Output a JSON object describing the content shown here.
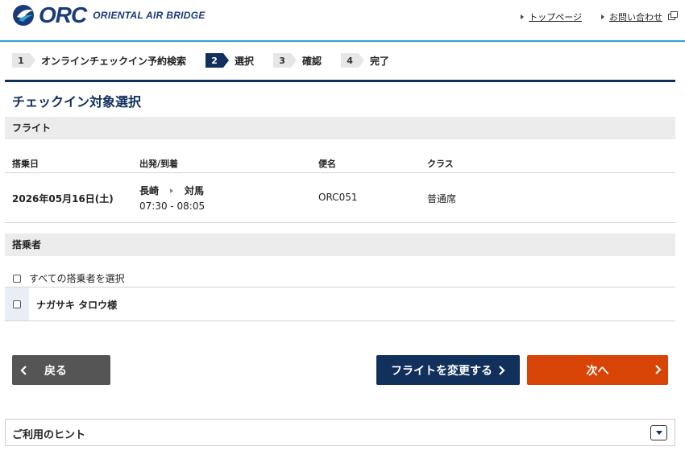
{
  "header": {
    "logo_text": "ORC",
    "logo_sub": "ORIENTAL AIR BRIDGE",
    "links": [
      {
        "label": "トップページ"
      },
      {
        "label": "お問い合わせ"
      }
    ]
  },
  "steps": [
    {
      "num": "1",
      "label": "オンラインチェックイン予約検索",
      "active": false
    },
    {
      "num": "2",
      "label": "選択",
      "active": true
    },
    {
      "num": "3",
      "label": "確認",
      "active": false
    },
    {
      "num": "4",
      "label": "完了",
      "active": false
    }
  ],
  "page_title": "チェックイン対象選択",
  "flight": {
    "section_label": "フライト",
    "headers": {
      "date": "搭乗日",
      "route": "出発/到着",
      "flight_no": "便名",
      "class": "クラス"
    },
    "date": "2026年05月16日(土)",
    "from": "長崎",
    "to": "対馬",
    "times": "07:30 - 08:05",
    "flight_no": "ORC051",
    "class": "普通席"
  },
  "passengers": {
    "section_label": "搭乗者",
    "select_all_label": "すべての搭乗者を選択",
    "list": [
      {
        "name": "ナガサキ タロウ様",
        "checked": false
      }
    ]
  },
  "buttons": {
    "back": "戻る",
    "change_flight": "フライトを変更する",
    "next": "次へ"
  },
  "hint": {
    "title": "ご利用のヒント"
  },
  "colors": {
    "navy": "#12305c",
    "accent_blue": "#2ea0da",
    "orange": "#d84405",
    "gray_button": "#555555"
  }
}
